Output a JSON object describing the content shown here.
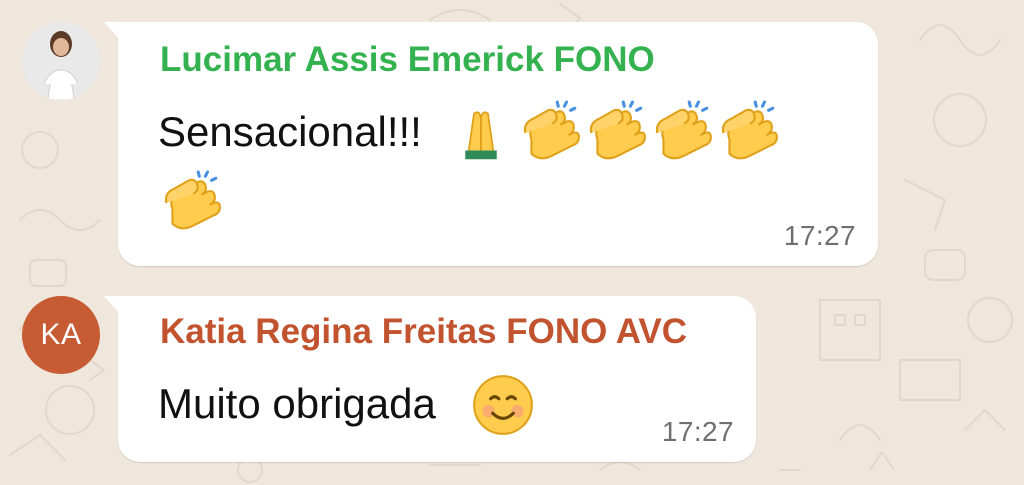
{
  "chat": {
    "messages": [
      {
        "sender": "Lucimar Assis Emerick FONO",
        "sender_color": "#34b24f",
        "text": "Sensacional!!!",
        "emojis": [
          "folded-hands-icon",
          "clapping-hands-icon",
          "clapping-hands-icon",
          "clapping-hands-icon",
          "clapping-hands-icon",
          "clapping-hands-icon"
        ],
        "time": "17:27",
        "avatar": "profile-photo"
      },
      {
        "sender": "Katia Regina Freitas FONO AVC",
        "sender_color": "#c2532f",
        "text": "Muito obrigada",
        "emojis": [
          "smiling-face-icon"
        ],
        "time": "17:27",
        "avatar_initials": "KA"
      }
    ]
  },
  "theme": {
    "background": "#efe6dc",
    "bubble": "#ffffff",
    "timestamp_color": "#6f6f6f"
  }
}
